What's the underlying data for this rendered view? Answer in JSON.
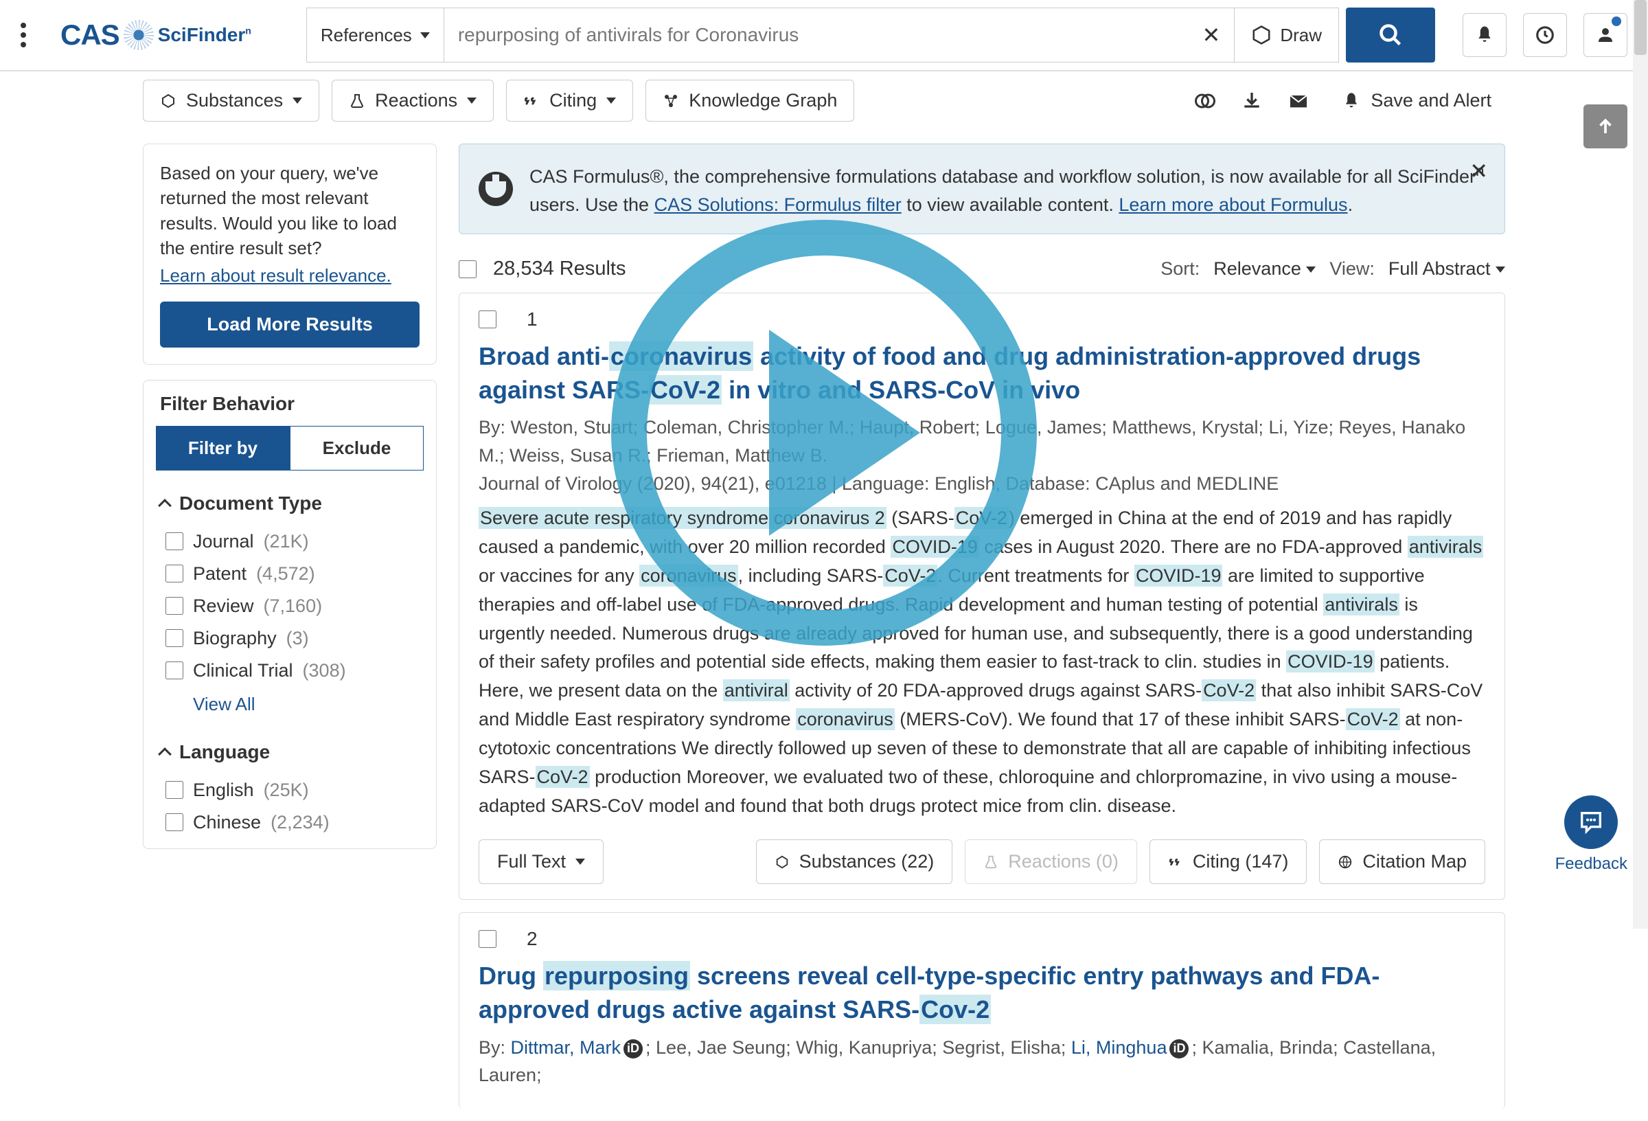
{
  "header": {
    "logo_cas": "CAS",
    "logo_sci": "SciFinder",
    "search_type": "References",
    "search_query": "repurposing of antivirals for Coronavirus",
    "draw_label": "Draw"
  },
  "toolbar": {
    "substances": "Substances",
    "reactions": "Reactions",
    "citing": "Citing",
    "knowledge_graph": "Knowledge Graph",
    "save_alert": "Save and Alert"
  },
  "promo": {
    "prefix": "CAS Formulus®, the comprehensive formulations database and workflow solution, is now available for all SciFinder",
    "sup": "n",
    "mid": " users. Use the ",
    "link1": "CAS Solutions: Formulus filter",
    "mid2": " to view available content. ",
    "link2": "Learn more about Formulus",
    "suffix": "."
  },
  "sidebar": {
    "relevance_text": "Based on your query, we've returned the most relevant results. Would you like to load the entire result set?",
    "relevance_link": "Learn about result relevance.",
    "load_more": "Load More Results",
    "filter_behavior": "Filter Behavior",
    "filter_by": "Filter by",
    "exclude": "Exclude",
    "doc_type_title": "Document Type",
    "doc_types": [
      {
        "label": "Journal",
        "count": "(21K)"
      },
      {
        "label": "Patent",
        "count": "(4,572)"
      },
      {
        "label": "Review",
        "count": "(7,160)"
      },
      {
        "label": "Biography",
        "count": "(3)"
      },
      {
        "label": "Clinical Trial",
        "count": "(308)"
      }
    ],
    "view_all": "View All",
    "language_title": "Language",
    "languages": [
      {
        "label": "English",
        "count": "(25K)"
      },
      {
        "label": "Chinese",
        "count": "(2,234)"
      }
    ]
  },
  "results_header": {
    "count": "28,534 Results",
    "sort_label": "Sort:",
    "sort_value": "Relevance",
    "view_label": "View:",
    "view_value": "Full Abstract"
  },
  "result1": {
    "num": "1",
    "title_pre": "Broad anti-",
    "title_hl1": "coronavirus",
    "title_mid1": " activity of food and drug administration-approved drugs against SARS-",
    "title_hl2": "CoV-2",
    "title_end": " in vitro and SARS-CoV in vivo",
    "authors": "By: Weston, Stuart; Coleman, Christopher M.; Haupt, Robert; Logue, James; Matthews, Krystal; Li, Yize; Reyes, Hanako M.; Weiss, Susan R.; Frieman, Matthew B.",
    "journal": "Journal of Virology (2020), 94(21), e01218 | Language: English, Database: CAplus and MEDLINE",
    "full_text": "Full Text",
    "substances": "Substances (22)",
    "reactions": "Reactions (0)",
    "citing": "Citing (147)",
    "citation_map": "Citation Map"
  },
  "result2": {
    "num": "2",
    "title_pre": "Drug ",
    "title_hl1": "repurposing",
    "title_mid1": " screens reveal cell-type-specific entry pathways and FDA-approved drugs active against SARS-",
    "title_hl2": "Cov-2",
    "auth_by": "By: ",
    "auth1": "Dittmar, Mark",
    "auth_mid1": "; Lee, Jae Seung; Whig, Kanupriya; Segrist, Elisha; ",
    "auth2": "Li, Minghua",
    "auth_end": "; Kamalia, Brinda; Castellana, Lauren;"
  },
  "feedback_label": "Feedback"
}
